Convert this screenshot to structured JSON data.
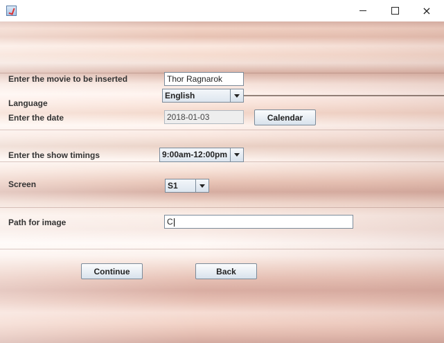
{
  "window": {
    "title": ""
  },
  "titlebar": {
    "minimize": "minimize",
    "maximize": "maximize",
    "close": "×"
  },
  "form": {
    "movie_label": "Enter the movie to be inserted",
    "movie_value": "Thor Ragnarok",
    "language_label": "Language",
    "language_value": "English",
    "date_label": "Enter the date",
    "date_value": "2018-01-03",
    "calendar_button": "Calendar",
    "timings_label": "Enter the show timings",
    "timings_value": "9:00am-12:00pm",
    "screen_label": "Screen",
    "screen_value": "S1",
    "path_label": "Path for image",
    "path_value": "C",
    "continue_button": "Continue",
    "back_button": "Back"
  },
  "colors": {
    "accent": "#7a8a99",
    "background": "#f6dccf"
  }
}
